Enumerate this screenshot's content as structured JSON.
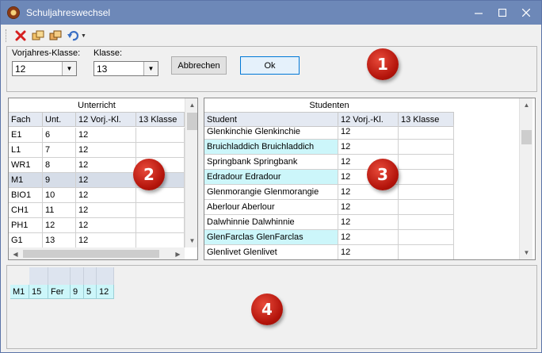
{
  "window": {
    "title": "Schuljahreswechsel",
    "controls": [
      "minimize-icon",
      "maximize-icon",
      "close-icon"
    ]
  },
  "toolbar": {
    "icons": [
      "delete-icon",
      "copy-icon",
      "copy-alt-icon",
      "undo-icon"
    ]
  },
  "top_panel": {
    "prev_class_label": "Vorjahres-Klasse:",
    "prev_class_value": "12",
    "class_label": "Klasse:",
    "class_value": "13",
    "cancel_label": "Abbrechen",
    "ok_label": "Ok"
  },
  "badges": [
    "1",
    "2",
    "3",
    "4"
  ],
  "unterricht": {
    "group_title": "Unterricht",
    "columns": [
      "Fach",
      "Unt.",
      "12 Vorj.-Kl.",
      "13 Klasse"
    ],
    "rows": [
      [
        "E1",
        "6",
        "12",
        ""
      ],
      [
        "L1",
        "7",
        "12",
        ""
      ],
      [
        "WR1",
        "8",
        "12",
        ""
      ],
      [
        "M1",
        "9",
        "12",
        ""
      ],
      [
        "BIO1",
        "10",
        "12",
        ""
      ],
      [
        "CH1",
        "11",
        "12",
        ""
      ],
      [
        "PH1",
        "12",
        "12",
        ""
      ],
      [
        "G1",
        "13",
        "12",
        ""
      ]
    ],
    "selected_row": 3
  },
  "studenten": {
    "group_title": "Studenten",
    "columns": [
      "Student",
      "12 Vorj.-Kl.",
      "13 Klasse"
    ],
    "rows": [
      [
        "Glenkinchie Glenkinchie",
        "12",
        ""
      ],
      [
        "Bruichladdich Bruichladdich",
        "12",
        ""
      ],
      [
        "Springbank Springbank",
        "12",
        ""
      ],
      [
        "Edradour Edradour",
        "12",
        ""
      ],
      [
        "Glenmorangie Glenmorangie",
        "12",
        ""
      ],
      [
        "Aberlour Aberlour",
        "12",
        ""
      ],
      [
        "Dalwhinnie Dalwhinnie",
        "12",
        ""
      ],
      [
        "GlenFarclas GlenFarclas",
        "12",
        ""
      ],
      [
        "Glenlivet Glenlivet",
        "12",
        ""
      ]
    ],
    "highlighted_rows": [
      1,
      3,
      7
    ]
  },
  "bottom": {
    "cells": [
      "M1",
      "15",
      "Fer",
      "9",
      "5",
      "12"
    ]
  },
  "colors": {
    "titlebar": "#6d88b8",
    "badge": "#c0180e",
    "cyan_highlight": "#ccf6fa",
    "selected_row": "#d6dde8"
  }
}
